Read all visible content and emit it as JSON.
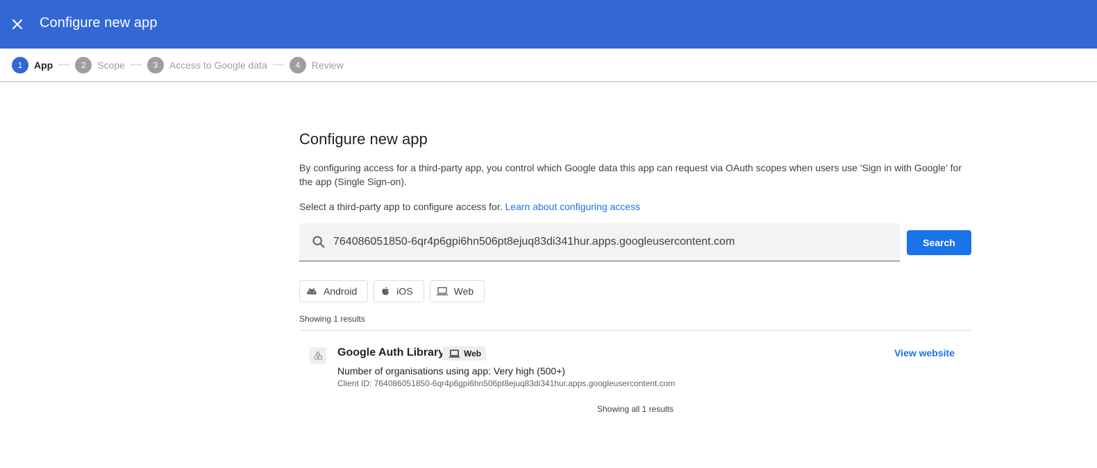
{
  "header": {
    "title": "Configure new app",
    "close_icon": "close-icon"
  },
  "stepper": {
    "steps": [
      {
        "number": "1",
        "label": "App",
        "active": true
      },
      {
        "number": "2",
        "label": "Scope",
        "active": false
      },
      {
        "number": "3",
        "label": "Access to Google data",
        "active": false
      },
      {
        "number": "4",
        "label": "Review",
        "active": false
      }
    ]
  },
  "main": {
    "title": "Configure new app",
    "description": "By configuring access for a third-party app, you control which Google data this app can request via OAuth scopes when users use 'Sign in with Google' for the app (Single Sign-on).",
    "select_text": "Select a third-party app to configure access for.",
    "learn_link": "Learn about configuring access",
    "search": {
      "value": "764086051850-6qr4p6gpi6hn506pt8ejuq83di341hur.apps.googleusercontent.com",
      "button_label": "Search"
    },
    "filters": [
      {
        "label": "Android",
        "icon": "android-icon"
      },
      {
        "label": "iOS",
        "icon": "apple-icon"
      },
      {
        "label": "Web",
        "icon": "laptop-icon"
      }
    ],
    "results_count_text": "Showing 1 results",
    "results": [
      {
        "name": "Google Auth Library",
        "badge": "Web",
        "orgs_text": "Number of organisations using app: Very high (500+)",
        "client_id_text": "Client ID: 764086051850-6qr4p6gpi6hn506pt8ejuq83di341hur.apps.googleusercontent.com",
        "action_label": "View website"
      }
    ],
    "footer_text": "Showing all 1 results"
  },
  "colors": {
    "header_bg": "#3367d6",
    "accent": "#1a73e8",
    "inactive_step": "#9e9e9e"
  }
}
